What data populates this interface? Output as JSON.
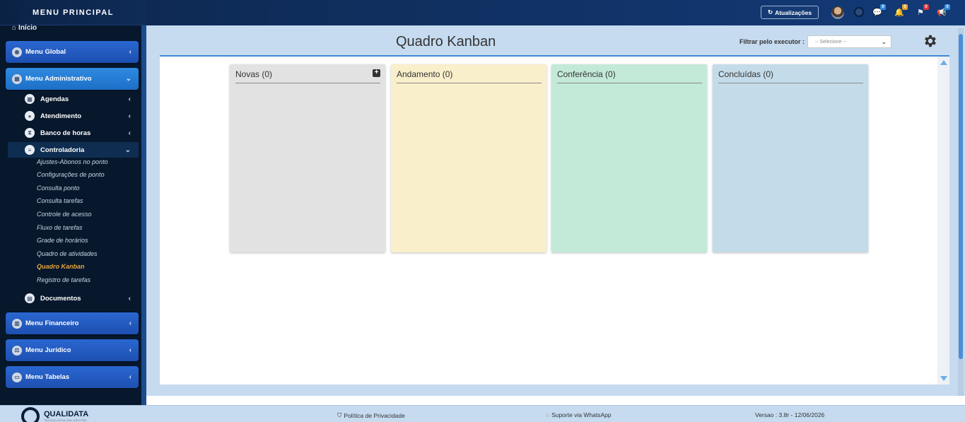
{
  "sidebar": {
    "title": "MENU PRINCIPAL",
    "home": "Início",
    "menus": [
      {
        "label": "Menu Global"
      },
      {
        "label": "Menu Administrativo"
      },
      {
        "label": "Menu Financeiro"
      },
      {
        "label": "Menu Jurídico"
      },
      {
        "label": "Menu Tabelas"
      }
    ],
    "submenus": [
      {
        "label": "Agendas"
      },
      {
        "label": "Atendimento"
      },
      {
        "label": "Banco de horas"
      },
      {
        "label": "Controladoria"
      },
      {
        "label": "Documentos"
      }
    ],
    "leaves": [
      "Ajustes-Abonos no ponto",
      "Configurações de ponto",
      "Consulta ponto",
      "Consulta tarefas",
      "Controle de acesso",
      "Fluxo de tarefas",
      "Grade de horários",
      "Quadro de atividades",
      "Quadro Kanban",
      "Registro de tarefas"
    ]
  },
  "topbar": {
    "updates_label": "Atualizações",
    "badges": [
      "0",
      "0",
      "0",
      "0"
    ],
    "colors": {
      "blue": "#2f8ae0",
      "yellow": "#e0a030",
      "red": "#d9363e"
    }
  },
  "main": {
    "title": "Quadro Kanban",
    "filter_label": "Filtrar pelo executor :",
    "filter_value": "-- Selecione --",
    "columns": [
      {
        "title": "Novas (0)",
        "color": "#e2e2e2"
      },
      {
        "title": "Andamento (0)",
        "color": "#f9efcb"
      },
      {
        "title": "Conferência (0)",
        "color": "#c3e9d8"
      },
      {
        "title": "Concluídas (0)",
        "color": "#c4dce9"
      }
    ]
  },
  "footer": {
    "brand": "QUALIDATA",
    "tagline": "TECNOLOGIA EM GESTÃO",
    "privacy": "Política de Privacidade",
    "support": "Suporte via WhatsApp",
    "version": "Versao : 3.8r - 12/06/2026"
  }
}
